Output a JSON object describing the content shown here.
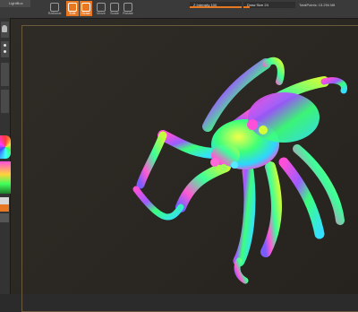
{
  "app": {
    "lightbox_label": "LightBox",
    "buttons": {
      "other_label": "Rational",
      "edit_label": "Edit",
      "draw_label": "Draw",
      "move_label": "Move",
      "scale_label": "Scale",
      "rotate_label": "Rotate"
    },
    "sliders": {
      "intensity_label": "Z Intensity 100",
      "intensity_level": 1.0,
      "draw_size_label": "Draw Size 24",
      "draw_size_level": 0.12
    },
    "total_points_label": "TotalPoints: 13.294 Mil"
  },
  "colors": {
    "accent": "#e87722",
    "canvas_bg": "#2b2722",
    "frame": "#6b5a3e"
  },
  "icons": {
    "brush": "brush-icon",
    "color_picker": "color-wheel-icon"
  }
}
